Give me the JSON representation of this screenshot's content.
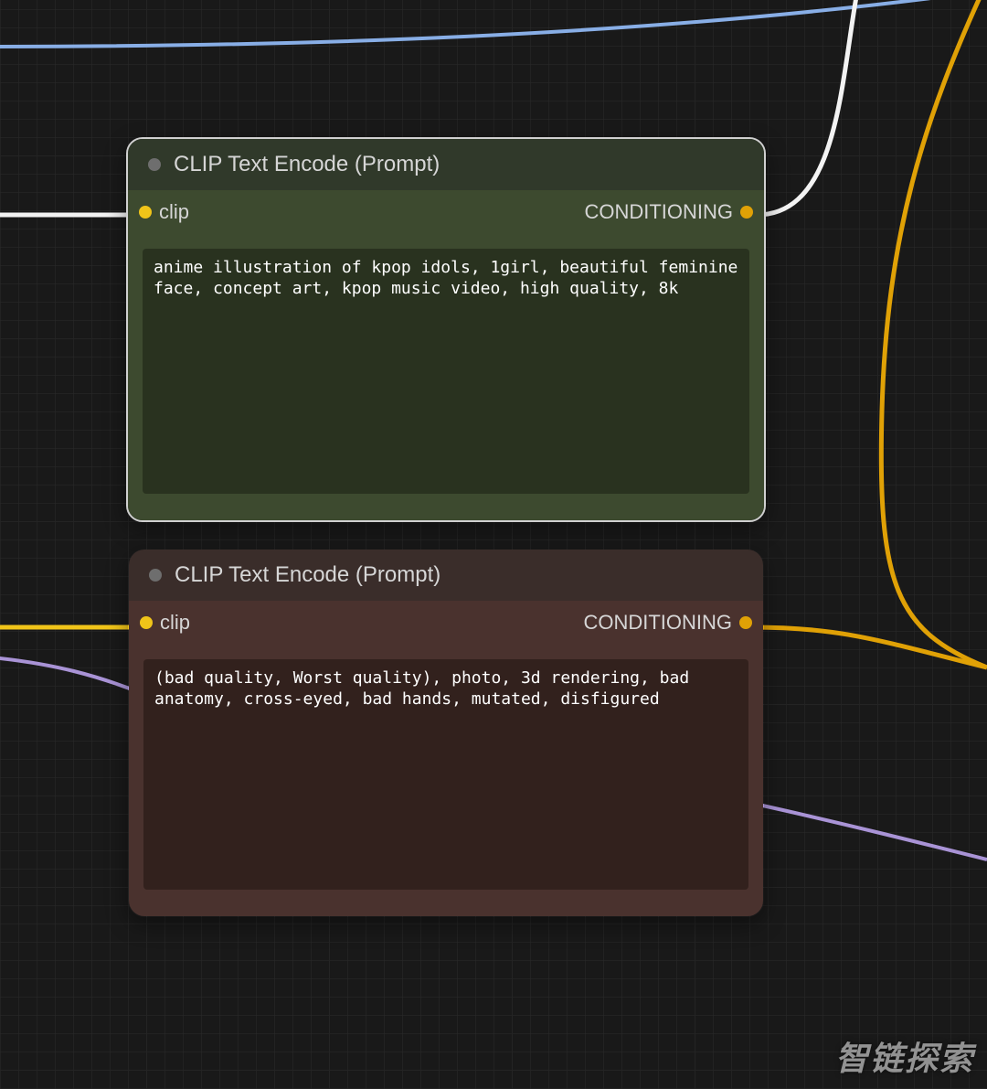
{
  "nodes": {
    "positive": {
      "title": "CLIP Text Encode (Prompt)",
      "input_label": "clip",
      "output_label": "CONDITIONING",
      "text": "anime illustration of kpop idols, 1girl, beautiful feminine face, concept art, kpop music video, high quality, 8k"
    },
    "negative": {
      "title": "CLIP Text Encode (Prompt)",
      "input_label": "clip",
      "output_label": "CONDITIONING",
      "text": "(bad quality, Worst quality), photo, 3d rendering, bad anatomy, cross-eyed, bad hands, mutated, disfigured"
    }
  },
  "ports": {
    "clip_color": "#f0c419",
    "conditioning_color": "#e0a106"
  },
  "watermark": "智链探索"
}
